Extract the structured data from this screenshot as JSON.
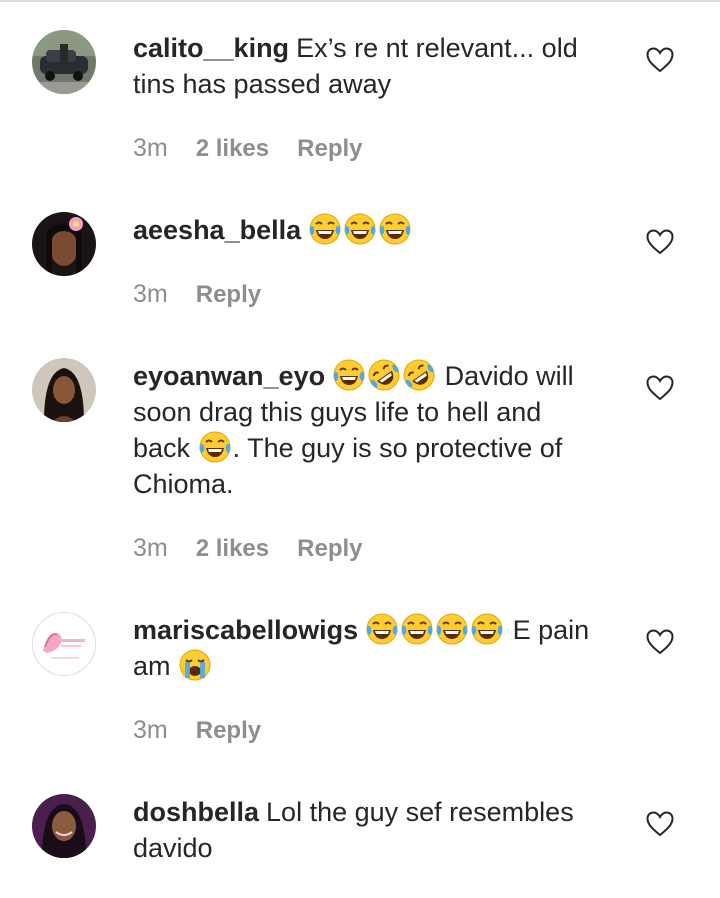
{
  "comments": [
    {
      "username": "calito__king",
      "text_lines": [
        "Ex’s re nt relevant... old",
        "tins has passed away"
      ],
      "time": "3m",
      "likes": "2 likes",
      "reply": "Reply"
    },
    {
      "username": "aeesha_bella",
      "emojis": [
        "laughing-tears",
        "laughing-tears",
        "laughing-tears"
      ],
      "time": "3m",
      "reply": "Reply"
    },
    {
      "username": "eyoanwan_eyo",
      "emojis": [
        "laughing-tears",
        "rolling-laughing",
        "rolling-laughing"
      ],
      "line1_text": "Davido will",
      "line2": "soon drag this guys life to hell and",
      "line3_pre": "back",
      "line3_post": ". The guy is so protective of",
      "line4": "Chioma.",
      "time": "3m",
      "likes": "2 likes",
      "reply": "Reply"
    },
    {
      "username": "mariscabellowigs",
      "emojis": [
        "laughing-tears",
        "laughing-tears",
        "laughing-tears",
        "laughing-tears"
      ],
      "line1_text": "E pain",
      "line2_pre": "am",
      "line2_emoji": "loudly-crying",
      "time": "3m",
      "reply": "Reply"
    },
    {
      "username": "doshbella",
      "text_lines": [
        "Lol the guy sef resembles",
        "davido"
      ]
    }
  ],
  "colors": {
    "text": "#262626",
    "meta": "#8e8e8e",
    "divider": "#dbdbdb",
    "emoji_face": "#ffcc33",
    "emoji_tear": "#4fa9e8"
  },
  "icons": {
    "like": "heart-outline-icon"
  }
}
